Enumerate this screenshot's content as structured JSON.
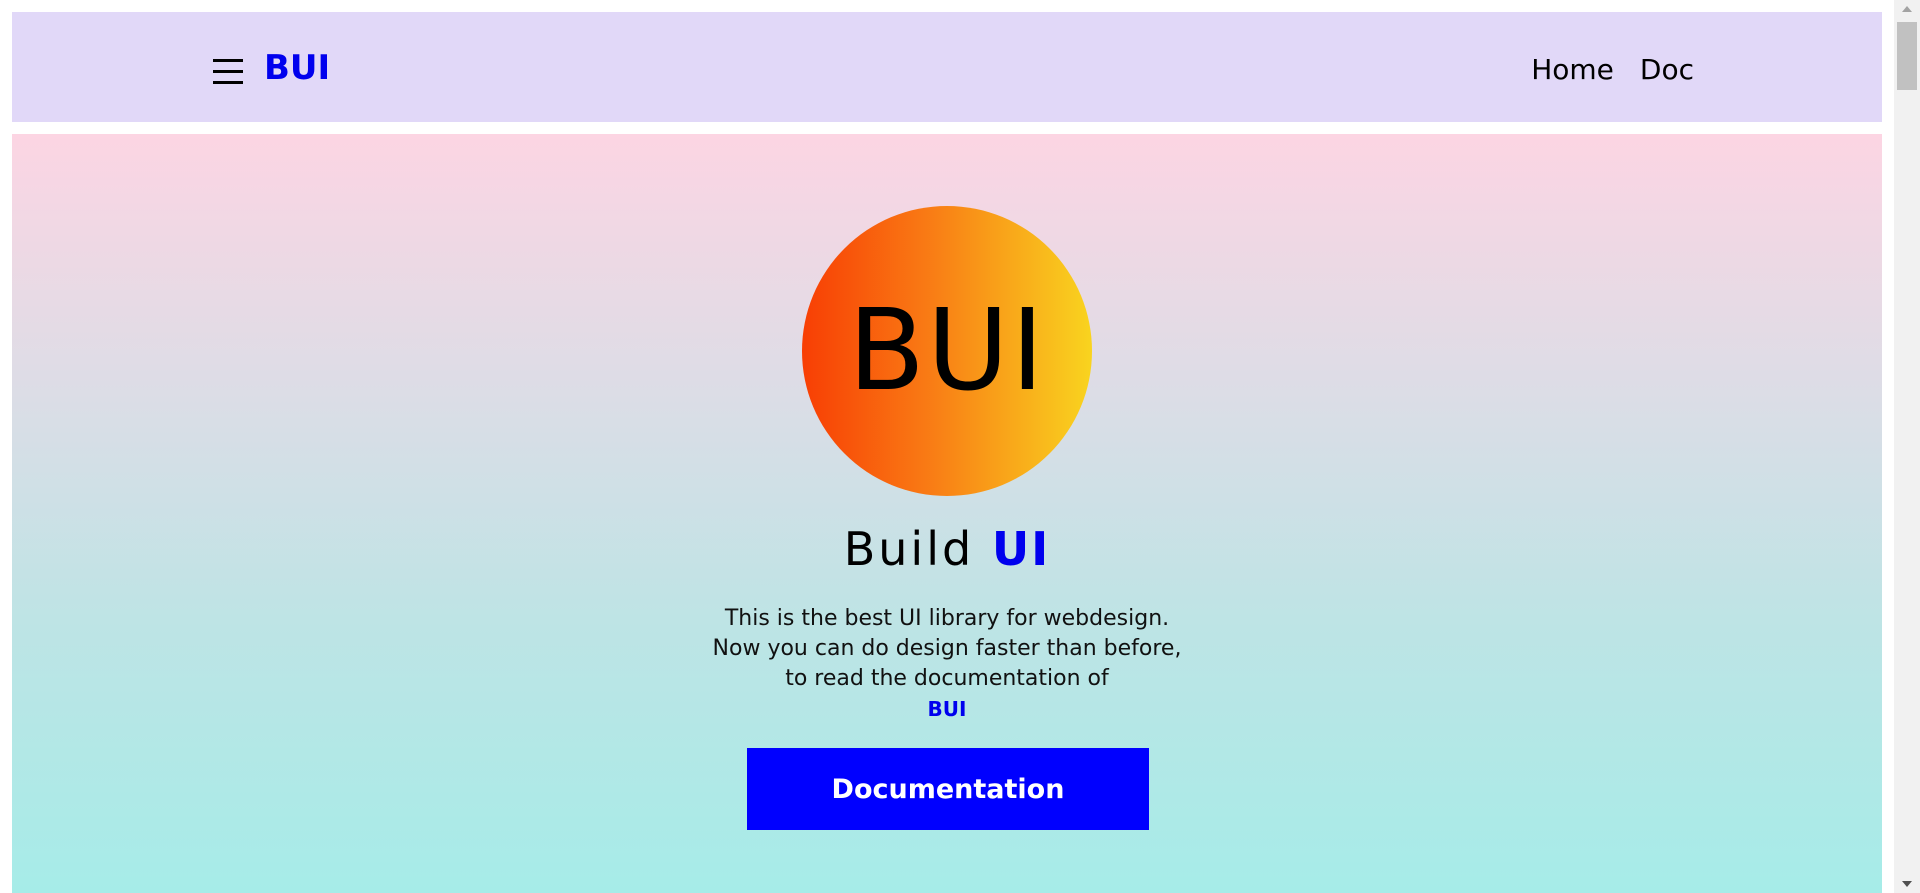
{
  "navbar": {
    "brand": "BUI",
    "menu_icon": "hamburger-menu-icon",
    "links": [
      {
        "label": "Home"
      },
      {
        "label": "Doc"
      }
    ],
    "background": "#e1d8f8",
    "brand_color": "#0000ee"
  },
  "hero": {
    "logo_text": "BUI",
    "title_prefix": "Build",
    "title_accent": "UI",
    "description": "This is the best UI library for webdesign. Now you can do design faster than before, to read the documentation of",
    "description_brand": "BUI",
    "button_label": "Documentation",
    "button_color": "#0000ff",
    "gradient_colors": [
      "#fcd5e3",
      "#a6ece8"
    ],
    "logo_gradient": [
      "#f83e04",
      "#f9d41f"
    ]
  }
}
